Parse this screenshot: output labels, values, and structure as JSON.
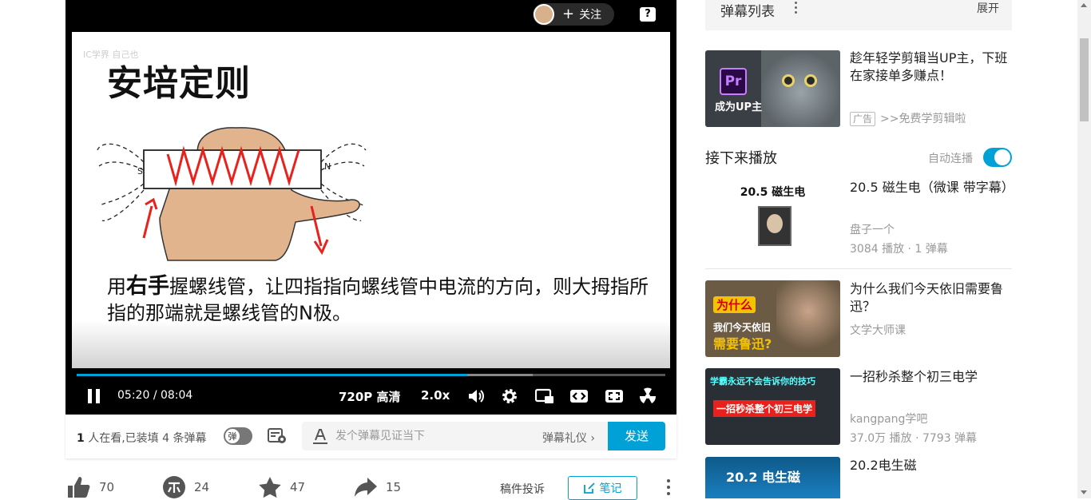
{
  "player": {
    "follow_label": "关注",
    "slide_watermark": "IC学界 自己也",
    "slide_title": "安培定则",
    "slide_text_pre": "用",
    "slide_text_bold": "右手",
    "slide_text_post": "握螺线管，让四指指向螺线管中电流的方向，则大拇指所指的那端就是螺线管的N极。",
    "diagram_s": "S",
    "diagram_n": "N",
    "progress": 0.663,
    "buffered": 0.775,
    "time_current": "05:20",
    "time_sep": "/",
    "time_total": "08:04",
    "quality": "720P 高清",
    "speed": "2.0x"
  },
  "danmaku_bar": {
    "viewers_count": "1",
    "viewers_text": "人在看,已装填 4 条弹幕",
    "toggle_label": "弹",
    "input_placeholder": "发个弹幕见证当下",
    "etiquette": "弹幕礼仪",
    "send": "发送"
  },
  "actions": {
    "like": "70",
    "coin": "24",
    "fav": "47",
    "share": "15",
    "report": "稿件投诉",
    "note": "笔记"
  },
  "sidebar": {
    "danmaku_list_title": "弹幕列表",
    "expand": "展开",
    "ad": {
      "title": "趁年轻学剪辑当UP主，下班在家接单多赚点！",
      "tag": "广告",
      "link": ">>免费学剪辑啦",
      "thumb_text": "成为UP主",
      "thumb_badge": "Pr"
    },
    "up_next_label": "接下来播放",
    "autoplay_label": "自动连播",
    "videos": [
      {
        "title": "20.5 磁生电（微课 带字幕）",
        "author": "盘子一个",
        "stats": "3084 播放 · 1 弹幕",
        "thumb_text": "20.5 磁生电"
      },
      {
        "title": "为什么我们今天依旧需要鲁迅？",
        "author": "文学大师课",
        "stats": "",
        "thumb_text": "为什么",
        "thumb_text2": "我们今天依旧",
        "thumb_text3": "需要鲁迅?"
      },
      {
        "title": "一招秒杀整个初三电学",
        "author": "kangpang学吧",
        "stats": "37.0万 播放 · 7793 弹幕",
        "thumb_text": "学霸永远不会告诉你的技巧",
        "thumb_text2": "一招秒杀整个初三电学"
      },
      {
        "title": "20.2电生磁",
        "author": "",
        "stats": "",
        "thumb_text": "20.2 电生磁"
      }
    ]
  },
  "colors": {
    "accent": "#00a1d6",
    "player_bg": "#000000",
    "sidebar_bg": "#f4f4f4"
  }
}
